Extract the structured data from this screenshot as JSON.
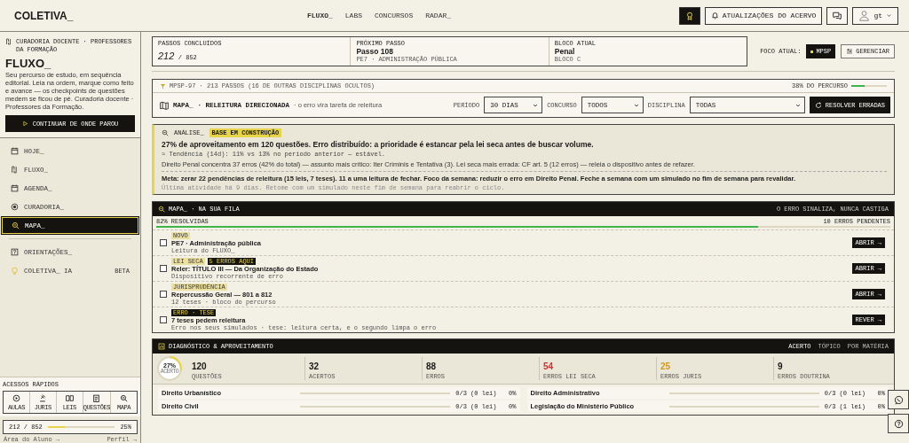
{
  "header": {
    "logo": "COLETIVA_",
    "nav": [
      {
        "label": "FLUXO_",
        "selected": true
      },
      {
        "label": "LABS",
        "selected": false
      },
      {
        "label": "CONCURSOS",
        "selected": false
      },
      {
        "label": "RADAR_",
        "selected": false
      }
    ],
    "updates_button": "ATUALIZAÇÕES DO ACERVO",
    "user": "gt"
  },
  "sidebar": {
    "eyebrow": "CURADORIA DOCENTE · PROFESSORES DA FORMAÇÃO",
    "title": "FLUXO_",
    "description": "Seu percurso de estudo, em sequência editorial. Leia na ordem, marque como feito e avance — os checkpoints de questões medem se ficou de pé. Curadoria docente · Professores da Formação.",
    "continue_button": "CONTINUAR DE ONDE PAROU",
    "nav": [
      {
        "label": "HOJE_",
        "selected": false
      },
      {
        "label": "FLUXO_",
        "selected": false
      },
      {
        "label": "AGENDA_",
        "selected": false
      },
      {
        "label": "CURADORIA_",
        "selected": false
      },
      {
        "label": "MAPA_",
        "selected": true
      }
    ],
    "nav2": [
      {
        "label": "ORIENTAÇÕES_",
        "selected": false
      },
      {
        "label": "COLETIVA_ IA",
        "selected": false,
        "badge": "BETA"
      }
    ],
    "quick_title": "ACESSOS RÁPIDOS",
    "quick": [
      {
        "label": "AULAS"
      },
      {
        "label": "JURIS"
      },
      {
        "label": "LEIS"
      },
      {
        "label": "QUESTÕES"
      },
      {
        "label": "MAPA"
      }
    ],
    "progress": {
      "count": "212 / 852",
      "level": 0.25,
      "percent": "25%"
    },
    "footer_left": "Área do Aluno →",
    "footer_right": "Perfil →"
  },
  "summary": [
    {
      "label": "PASSOS CONCLUÍDOS",
      "value": "212",
      "total": "/ 852"
    },
    {
      "label": "PRÓXIMO PASSO",
      "value": "Passo 108",
      "sub": "PE7 · ADMINISTRAÇÃO PÚBLICA"
    },
    {
      "label": "BLOCO ATUAL",
      "value": "Penal",
      "sub": "BLOCO C"
    }
  ],
  "focus": {
    "label": "FOCO ATUAL:",
    "chip": "MPSP",
    "manage": "GERENCIAR"
  },
  "filter": {
    "text": "MPSP-97 · 213 PASSOS (16 DE OUTRAS DISCIPLINAS OCULTOS)",
    "progress_label": "38% DO PERCURSO",
    "level": 0.38
  },
  "map": {
    "title": "MAPA_",
    "subtitle": "· RELEITURA DIRECIONADA",
    "note": "· o erro vira tarefa de releitura",
    "selects": [
      {
        "label": "PERÍODO",
        "value": "30 DIAS"
      },
      {
        "label": "CONCURSO",
        "value": "TODOS"
      },
      {
        "label": "DISCIPLINA",
        "value": "TODAS"
      }
    ],
    "button": "RESOLVER ERRADAS"
  },
  "analysis": {
    "title": "ANÁLISE_",
    "badge": "BASE EM CONSTRUÇÃO",
    "headline": "27% de aproveitamento em 120 questões. Erro distribuído: a prioridade é estancar pela lei seca antes de buscar volume.",
    "trend": "≈ Tendência (14d): 11% vs 13% no período anterior — estável.",
    "body": "Direito Penal concentra 37 erros (42% do total) — assunto mais crítico: Iter Criminis e Tentativa (3). Lei seca mais errada: CF art. 5 (12 erros) — releia o dispositivo antes de refazer.",
    "goal": "Meta: zerar 22 pendências de releitura (15 leis, 7 teses). 11 a uma leitura de fechar. Foco da semana: reduzir o erro em Direito Penal. Feche a semana com um simulado no fim de semana para revalidar.",
    "last": "Última atividade há 9 dias. Retome com um simulado neste fim de semana para reabrir o ciclo."
  },
  "queue": {
    "title": "MAPA_ · NA SUA FILA",
    "motto": "O ERRO SINALIZA, NUNCA CASTIGA",
    "resolved": "82% RESOLVIDAS",
    "pending": "10 ERROS PENDENTES",
    "level": 0.82,
    "items": [
      {
        "tags": [
          {
            "text": "NOVO",
            "kind": "light"
          }
        ],
        "title": "PE7 · Administração pública",
        "sub": "Leitura do FLUXO_",
        "button": "ABRIR →",
        "checked": false
      },
      {
        "tags": [
          {
            "text": "LEI SECA",
            "kind": "light"
          },
          {
            "text": "5 ERROS AQUI",
            "kind": "dark"
          }
        ],
        "title": "Reler: TÍTULO III — Da Organização do Estado",
        "sub": "Dispositivo recorrente de erro",
        "button": "ABRIR →",
        "checked": false
      },
      {
        "tags": [
          {
            "text": "JURISPRUDÊNCIA",
            "kind": "light"
          }
        ],
        "title": "Repercussão Geral — 801 a 812",
        "sub": "12 teses · bloco do percurso",
        "button": "ABRIR →",
        "checked": false
      },
      {
        "tags": [
          {
            "text": "ERRO · TESE",
            "kind": "dark"
          }
        ],
        "title": "7 teses pedem releitura",
        "sub": "Erro nos seus simulados · tese: leitura certa, e o segundo limpa o erro",
        "button": "REVER →",
        "checked": false
      }
    ]
  },
  "diagnostics": {
    "title": "DIAGNÓSTICO & APROVEITAMENTO",
    "tabs": [
      {
        "label": "ACERTO",
        "selected": true
      },
      {
        "label": "TÓPICO",
        "selected": false
      },
      {
        "label": "POR MATÉRIA",
        "selected": false
      }
    ],
    "ring": {
      "value": "27%",
      "label": "ACERTO",
      "level": 0.27
    },
    "stats": [
      {
        "value": "120",
        "label": "QUESTÕES",
        "color": "#1a1a1a"
      },
      {
        "value": "32",
        "label": "ACERTOS",
        "color": "#1a1a1a"
      },
      {
        "value": "88",
        "label": "ERROS",
        "color": "#1a1a1a"
      },
      {
        "value": "54",
        "label": "ERROS LEI SECA",
        "color": "#d03030"
      },
      {
        "value": "25",
        "label": "ERROS JURIS",
        "color": "#d09a20"
      },
      {
        "value": "9",
        "label": "ERROS DOUTRINA",
        "color": "#1a1a1a"
      }
    ],
    "subjects": [
      {
        "name": "Direito Urbanístico",
        "count": "0/3 (0 lei)",
        "percent": "0%"
      },
      {
        "name": "Direito Administrativo",
        "count": "0/3 (0 lei)",
        "percent": "0%"
      },
      {
        "name": "Direito Civil",
        "count": "0/3 (0 lei)",
        "percent": "0%"
      },
      {
        "name": "Legislação do Ministério Público",
        "count": "0/3 (1 lei)",
        "percent": "0%"
      }
    ]
  }
}
